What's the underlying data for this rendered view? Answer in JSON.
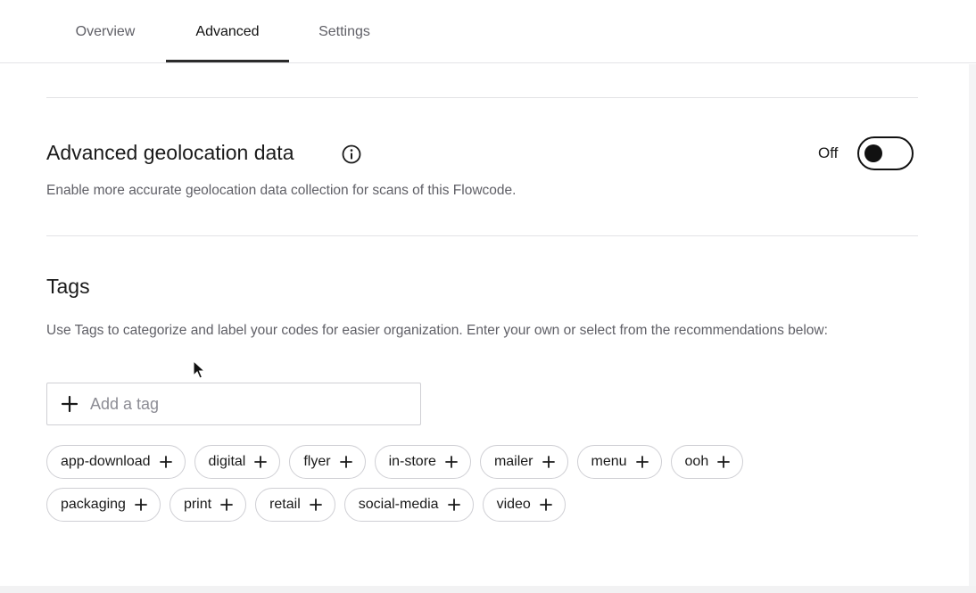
{
  "tabs": {
    "overview": "Overview",
    "advanced": "Advanced",
    "settings": "Settings"
  },
  "active_tab": "Advanced",
  "geolocation": {
    "title": "Advanced geolocation data",
    "description": "Enable more accurate geolocation data collection for scans of this Flowcode.",
    "toggle_label": "Off",
    "enabled": false
  },
  "tags": {
    "title": "Tags",
    "description": "Use Tags to categorize and label your codes for easier organization. Enter your own or select from the recommendations below:",
    "input_placeholder": "Add a tag",
    "row1": [
      "app-download",
      "digital",
      "flyer",
      "in-store",
      "mailer",
      "menu",
      "ooh"
    ],
    "row2": [
      "packaging",
      "print",
      "retail",
      "social-media",
      "video"
    ]
  },
  "icons": {
    "info": "info-icon",
    "add": "plus-icon",
    "cursor": "mouse-pointer-icon"
  }
}
